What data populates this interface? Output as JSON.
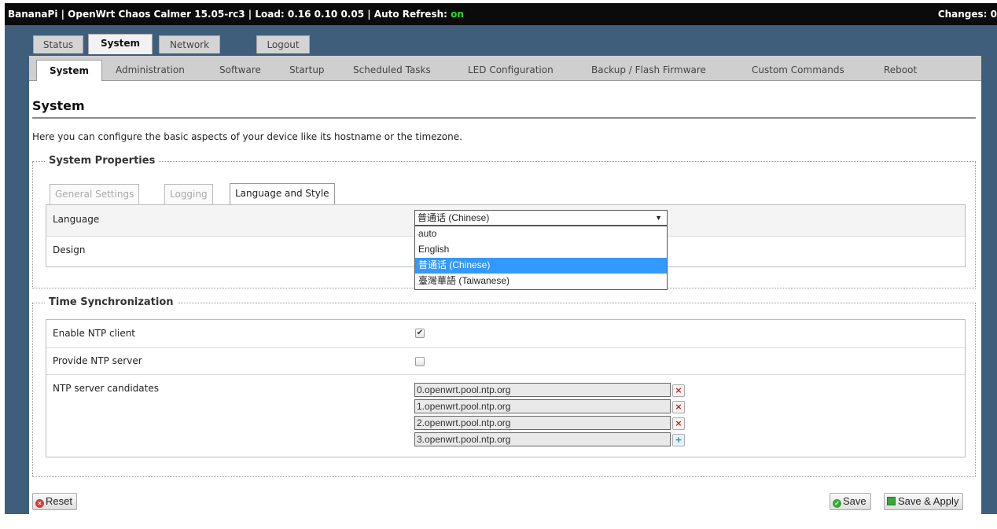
{
  "topbar": {
    "prefix": "BananaPi | OpenWrt Chaos Calmer 15.05-rc3 | Load: 0.16 0.10 0.05 | Auto Refresh: ",
    "auto_refresh_state": "on",
    "changes": "Changes: 0"
  },
  "main_tabs": [
    "Status",
    "System",
    "Network",
    "Logout"
  ],
  "sub_tabs": [
    "System",
    "Administration",
    "Software",
    "Startup",
    "Scheduled Tasks",
    "LED Configuration",
    "Backup / Flash Firmware",
    "Custom Commands",
    "Reboot"
  ],
  "page": {
    "title": "System",
    "description": "Here you can configure the basic aspects of your device like its hostname or the timezone."
  },
  "system_properties": {
    "legend": "System Properties",
    "tabs": [
      "General Settings",
      "Logging",
      "Language and Style"
    ],
    "language_label": "Language",
    "language_selected": "普通话 (Chinese)",
    "language_options": [
      "auto",
      "English",
      "普通话 (Chinese)",
      "臺灣華語 (Taiwanese)"
    ],
    "design_label": "Design"
  },
  "time_sync": {
    "legend": "Time Synchronization",
    "enable_ntp_label": "Enable NTP client",
    "enable_ntp_checked": true,
    "provide_ntp_label": "Provide NTP server",
    "provide_ntp_checked": false,
    "candidates_label": "NTP server candidates",
    "candidates": [
      "0.openwrt.pool.ntp.org",
      "1.openwrt.pool.ntp.org",
      "2.openwrt.pool.ntp.org",
      "3.openwrt.pool.ntp.org"
    ]
  },
  "buttons": {
    "reset": "Reset",
    "save": "Save",
    "save_apply": "Save & Apply"
  },
  "colors": {
    "accent_selected": "#3399ff",
    "frame_bg": "#3f5e7b",
    "topbar_bg": "#0b0b0b",
    "auto_refresh_on": "#22dd22"
  },
  "icons": {
    "checkmark": "check-icon",
    "delete": "remove-icon",
    "add": "add-icon",
    "reset": "reset-icon",
    "save": "save-icon",
    "apply": "apply-icon"
  }
}
